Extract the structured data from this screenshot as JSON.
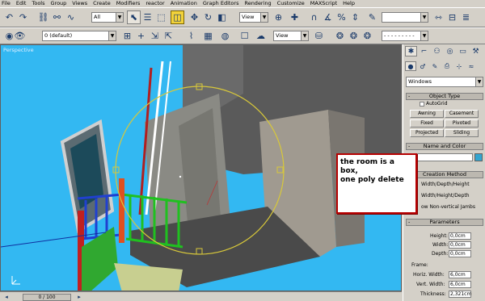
{
  "menu": [
    "File",
    "Edit",
    "Tools",
    "Group",
    "Views",
    "Create",
    "Modifiers",
    "reactor",
    "Animation",
    "Graph Editors",
    "Rendering",
    "Customize",
    "MAXScript",
    "Help"
  ],
  "toolbar1": {
    "selection_filter": "All",
    "reference_coord": "View",
    "named_selection": ""
  },
  "toolbar2": {
    "layer": "0 (default)",
    "coord_system": "View"
  },
  "viewport": {
    "label": "Perspective"
  },
  "command_panel": {
    "category": "Windows",
    "object_type": {
      "title": "Object Type",
      "autogrid": "AutoGrid",
      "buttons": [
        "Awning",
        "Casement",
        "Fixed",
        "Pivoted",
        "Projected",
        "Sliding"
      ]
    },
    "name_color": {
      "title": "Name and Color"
    },
    "creation_method": {
      "title": "Creation Method",
      "options": [
        "Width/Depth/Height",
        "Width/Height/Depth",
        "Allow Non-vertical Jambs"
      ],
      "visible_texts": [
        "Width/Depth/Height",
        "Width/Height/Depth",
        "ow Non-vertical Jambs"
      ]
    },
    "parameters": {
      "title": "Parameters",
      "fields": [
        {
          "label": "Height:",
          "value": "0,0cm"
        },
        {
          "label": "Width:",
          "value": "0,0cm"
        },
        {
          "label": "Depth:",
          "value": "0,0cm"
        }
      ],
      "frame": {
        "title": "Frame:",
        "fields": [
          {
            "label": "Horiz. Width:",
            "value": "6,0cm"
          },
          {
            "label": "Vert. Width:",
            "value": "6,0cm"
          },
          {
            "label": "Thickness:",
            "value": "2,321cm"
          }
        ]
      }
    }
  },
  "annotation": {
    "line1": "the room is a box,",
    "line2": "one poly delete"
  },
  "status": {
    "time_slider": "0 / 100"
  },
  "colors": {
    "viewport_bg": "#33b8f2",
    "ui_gray": "#d4d0c8",
    "annotation_border": "#b60000"
  }
}
